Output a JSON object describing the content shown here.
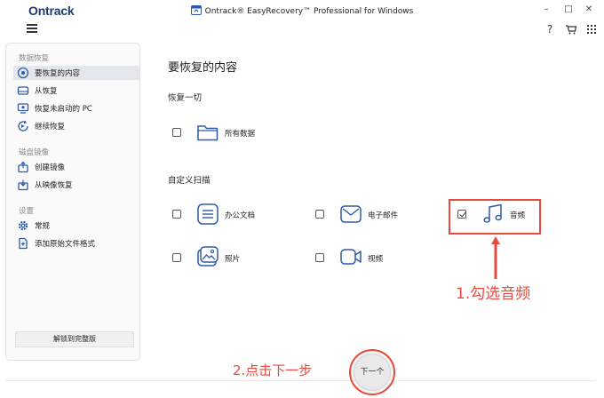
{
  "app": {
    "brand": "Ontrack",
    "window_title": "Ontrack® EasyRecovery™ Professional for Windows",
    "controls": {
      "minimize": "–",
      "maximize": "□",
      "close": "✕"
    },
    "help": "?"
  },
  "sidebar": {
    "sections": [
      {
        "label": "数据恢复",
        "items": [
          {
            "label": "要恢复的内容",
            "icon": "target-icon",
            "active": true
          },
          {
            "label": "从恢复",
            "icon": "drive-icon"
          },
          {
            "label": "恢复未启动的 PC",
            "icon": "pc-icon"
          },
          {
            "label": "继续恢复",
            "icon": "resume-icon"
          }
        ]
      },
      {
        "label": "磁盘镜像",
        "items": [
          {
            "label": "创建镜像",
            "icon": "create-image-icon"
          },
          {
            "label": "从映像恢复",
            "icon": "restore-image-icon"
          }
        ]
      },
      {
        "label": "设置",
        "items": [
          {
            "label": "常规",
            "icon": "gear-icon"
          },
          {
            "label": "添加原始文件格式",
            "icon": "add-file-icon"
          }
        ]
      }
    ],
    "unlock_button": "解锁到完整版"
  },
  "main": {
    "title": "要恢复的内容",
    "recover_all": {
      "heading": "恢复一切",
      "all_data_label": "所有数据"
    },
    "custom_scan": {
      "heading": "自定义扫描",
      "options": [
        {
          "label": "办公文档",
          "icon": "document-icon",
          "checked": false
        },
        {
          "label": "电子邮件",
          "icon": "email-icon",
          "checked": false
        },
        {
          "label": "音频",
          "icon": "music-icon",
          "checked": true
        },
        {
          "label": "照片",
          "icon": "photo-icon",
          "checked": false
        },
        {
          "label": "视频",
          "icon": "video-icon",
          "checked": false
        }
      ]
    },
    "next_button": "下一个"
  },
  "annotations": {
    "step1": "1.勾选音频",
    "step2": "2.点击下一步",
    "color": "#e84a3d"
  },
  "colors": {
    "brand": "#1f3b70",
    "icon_blue": "#2e5aa8",
    "active_bg": "#e4e7ed"
  }
}
